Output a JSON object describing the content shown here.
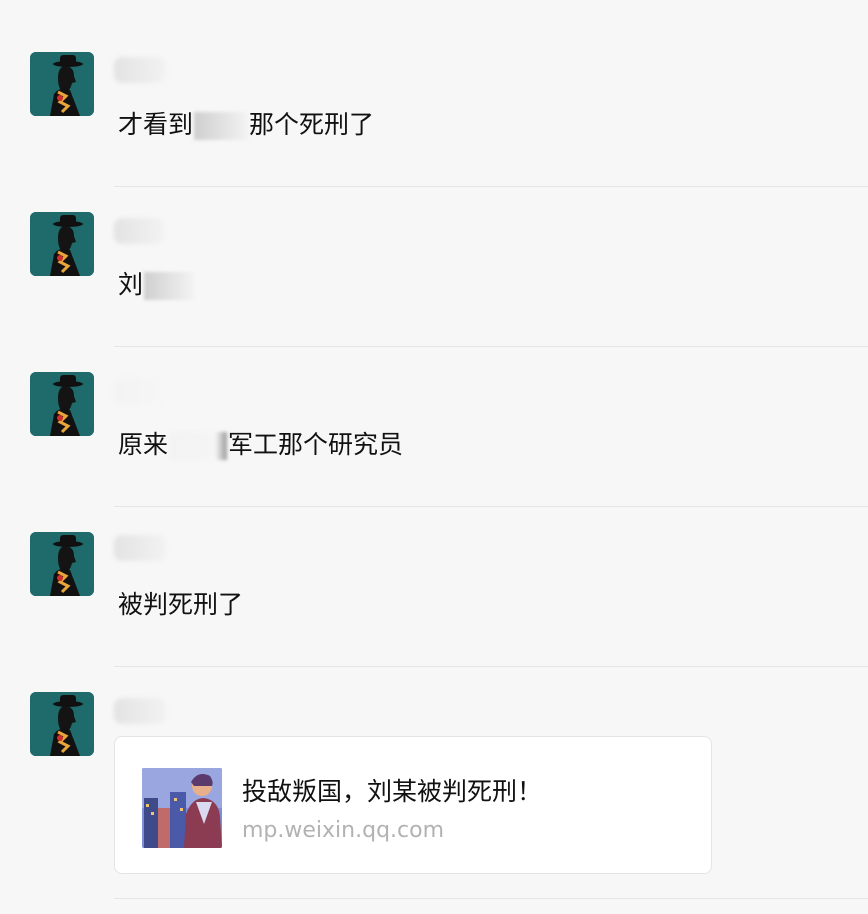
{
  "messages": [
    {
      "parts": [
        "才看到",
        "那个死刑了"
      ]
    },
    {
      "parts": [
        "刘"
      ]
    },
    {
      "parts": [
        "原来",
        "军工那个研究员"
      ]
    },
    {
      "parts": [
        "被判死刑了"
      ]
    }
  ],
  "link_card": {
    "title": "投敌叛国，刘某被判死刑！",
    "source": "mp.weixin.qq.com"
  },
  "colors": {
    "background": "#f7f7f7",
    "avatar_bg": "#1f6a6b",
    "card_bg": "#ffffff",
    "source_text": "#b2b2b2"
  },
  "icons": {
    "avatar": "man-in-hat-silhouette-avatar",
    "card_thumbnail": "illustration-thumbnail"
  }
}
